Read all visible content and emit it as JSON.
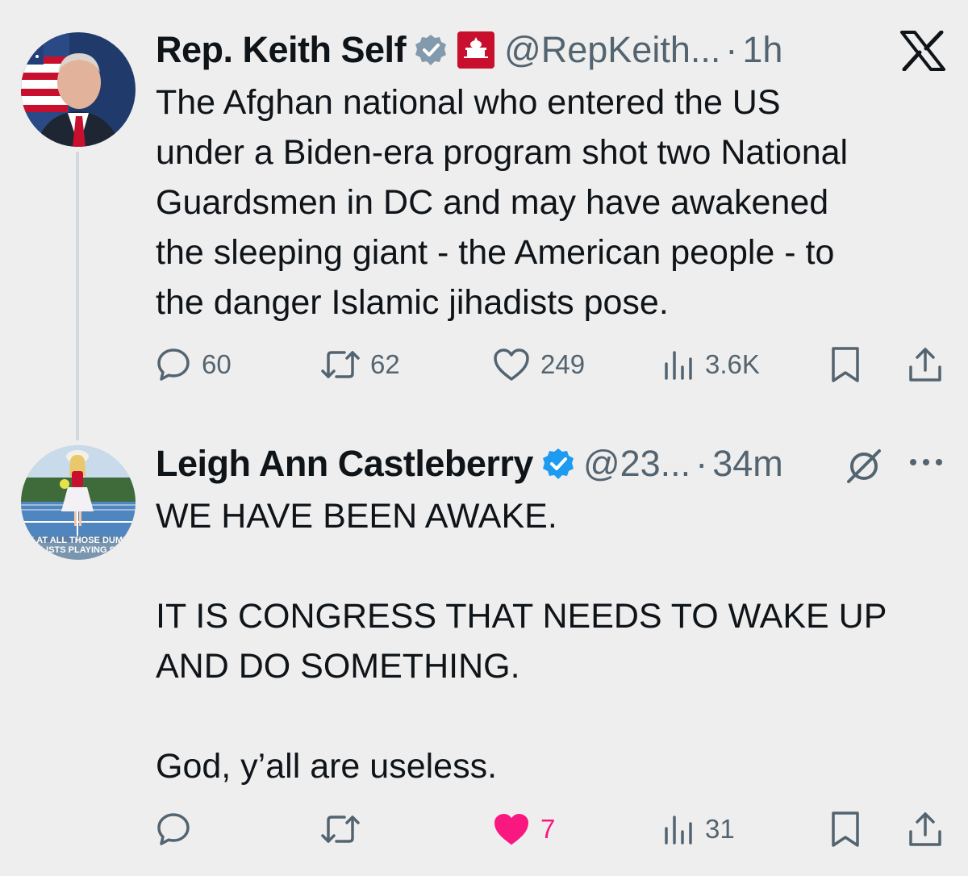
{
  "tweet1": {
    "name": "Rep. Keith Self",
    "handle": "@RepKeith...",
    "time": "1h",
    "affiliate_badge_text": "HOUSE GOP",
    "text": "The Afghan national who entered the US\nunder a Biden-era program shot two National\nGuardsmen in DC and may have awakened\nthe sleeping giant - the American people - to\nthe danger Islamic jihadists pose.",
    "replies": "60",
    "reposts": "62",
    "likes": "249",
    "views": "3.6K"
  },
  "tweet2": {
    "name": "Leigh Ann Castleberry",
    "handle": "@23...",
    "time": "34m",
    "avatar_caption": "OK AT ALL THOSE DUMBA\nALISTS PLAYING SO",
    "text": "WE HAVE BEEN AWAKE.\n\nIT IS CONGRESS THAT NEEDS TO WAKE UP\nAND DO SOMETHING.\n\nGod, y’all are useless.",
    "likes": "7",
    "views": "31"
  },
  "icons": {
    "brand": "x-logo-icon",
    "verified": "verified-badge-icon",
    "reply": "reply-icon",
    "repost": "repost-icon",
    "like": "heart-icon",
    "views": "views-icon",
    "bookmark": "bookmark-icon",
    "share": "share-icon",
    "grok": "grok-icon",
    "more": "more-icon"
  },
  "colors": {
    "background": "#efeeee",
    "text": "#0f1419",
    "secondary": "#536471",
    "verified_gray": "#829aab",
    "verified_blue": "#1d9bf0",
    "like_active": "#f91880",
    "gop_red": "#c8102e"
  }
}
